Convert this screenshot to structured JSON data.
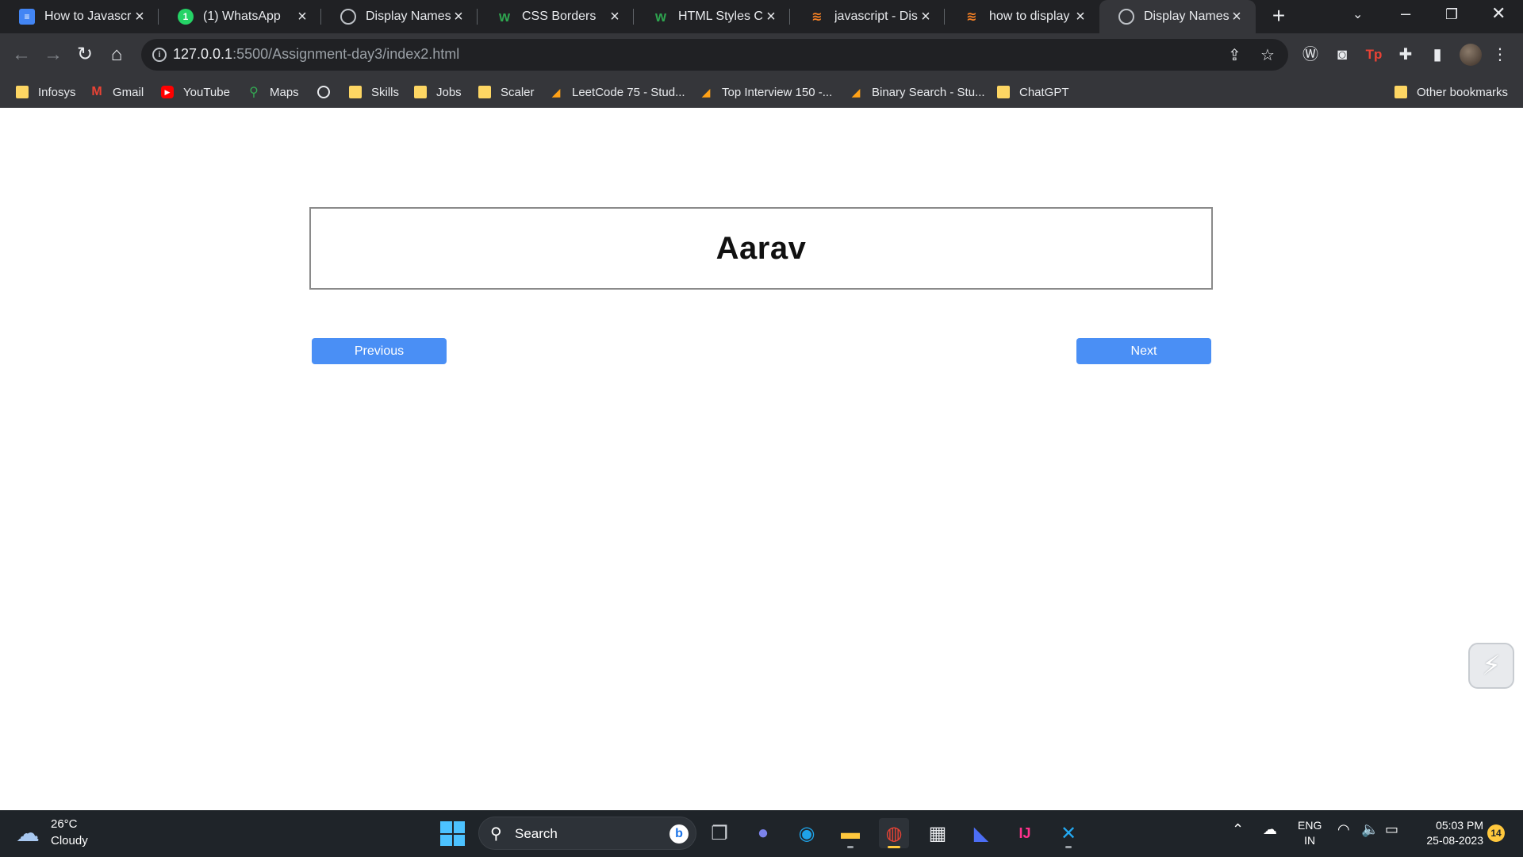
{
  "browser": {
    "tabs": [
      {
        "title": "How to Javascript",
        "favicon": "google-docs-icon"
      },
      {
        "title": "(1) WhatsApp",
        "favicon": "whatsapp-icon",
        "badge": "1"
      },
      {
        "title": "Display Names",
        "favicon": "globe-icon"
      },
      {
        "title": "CSS Borders",
        "favicon": "w3schools-icon"
      },
      {
        "title": "HTML Styles CSS",
        "favicon": "w3schools-icon"
      },
      {
        "title": "javascript - Displa",
        "favicon": "stackoverflow-icon"
      },
      {
        "title": "how to display a j",
        "favicon": "stackoverflow-icon"
      },
      {
        "title": "Display Names",
        "favicon": "globe-icon",
        "active": true
      }
    ],
    "address": {
      "host": "127.0.0.1",
      "path": ":5500/Assignment-day3/index2.html"
    },
    "bookmarks": [
      {
        "label": "Infosys",
        "icon": "folder-icon"
      },
      {
        "label": "Gmail",
        "icon": "gmail-icon"
      },
      {
        "label": "YouTube",
        "icon": "youtube-icon"
      },
      {
        "label": "Maps",
        "icon": "maps-icon"
      },
      {
        "label": "",
        "icon": "globe-icon"
      },
      {
        "label": "Skills",
        "icon": "folder-icon"
      },
      {
        "label": "Jobs",
        "icon": "folder-icon"
      },
      {
        "label": "Scaler",
        "icon": "folder-icon"
      },
      {
        "label": "LeetCode 75 - Stud...",
        "icon": "leetcode-icon"
      },
      {
        "label": "Top Interview 150 -...",
        "icon": "leetcode-icon"
      },
      {
        "label": "Binary Search - Stu...",
        "icon": "leetcode-icon"
      },
      {
        "label": "ChatGPT",
        "icon": "folder-icon"
      },
      {
        "label": "Other bookmarks",
        "icon": "folder-icon"
      }
    ]
  },
  "page": {
    "name": "Aarav",
    "previous_label": "Previous",
    "next_label": "Next",
    "button_color": "#4a8ff5"
  },
  "taskbar": {
    "weather": {
      "temp": "26°C",
      "desc": "Cloudy"
    },
    "search_label": "Search",
    "lang_line1": "ENG",
    "lang_line2": "IN",
    "time": "05:03 PM",
    "date": "25-08-2023",
    "notifications": "14"
  }
}
